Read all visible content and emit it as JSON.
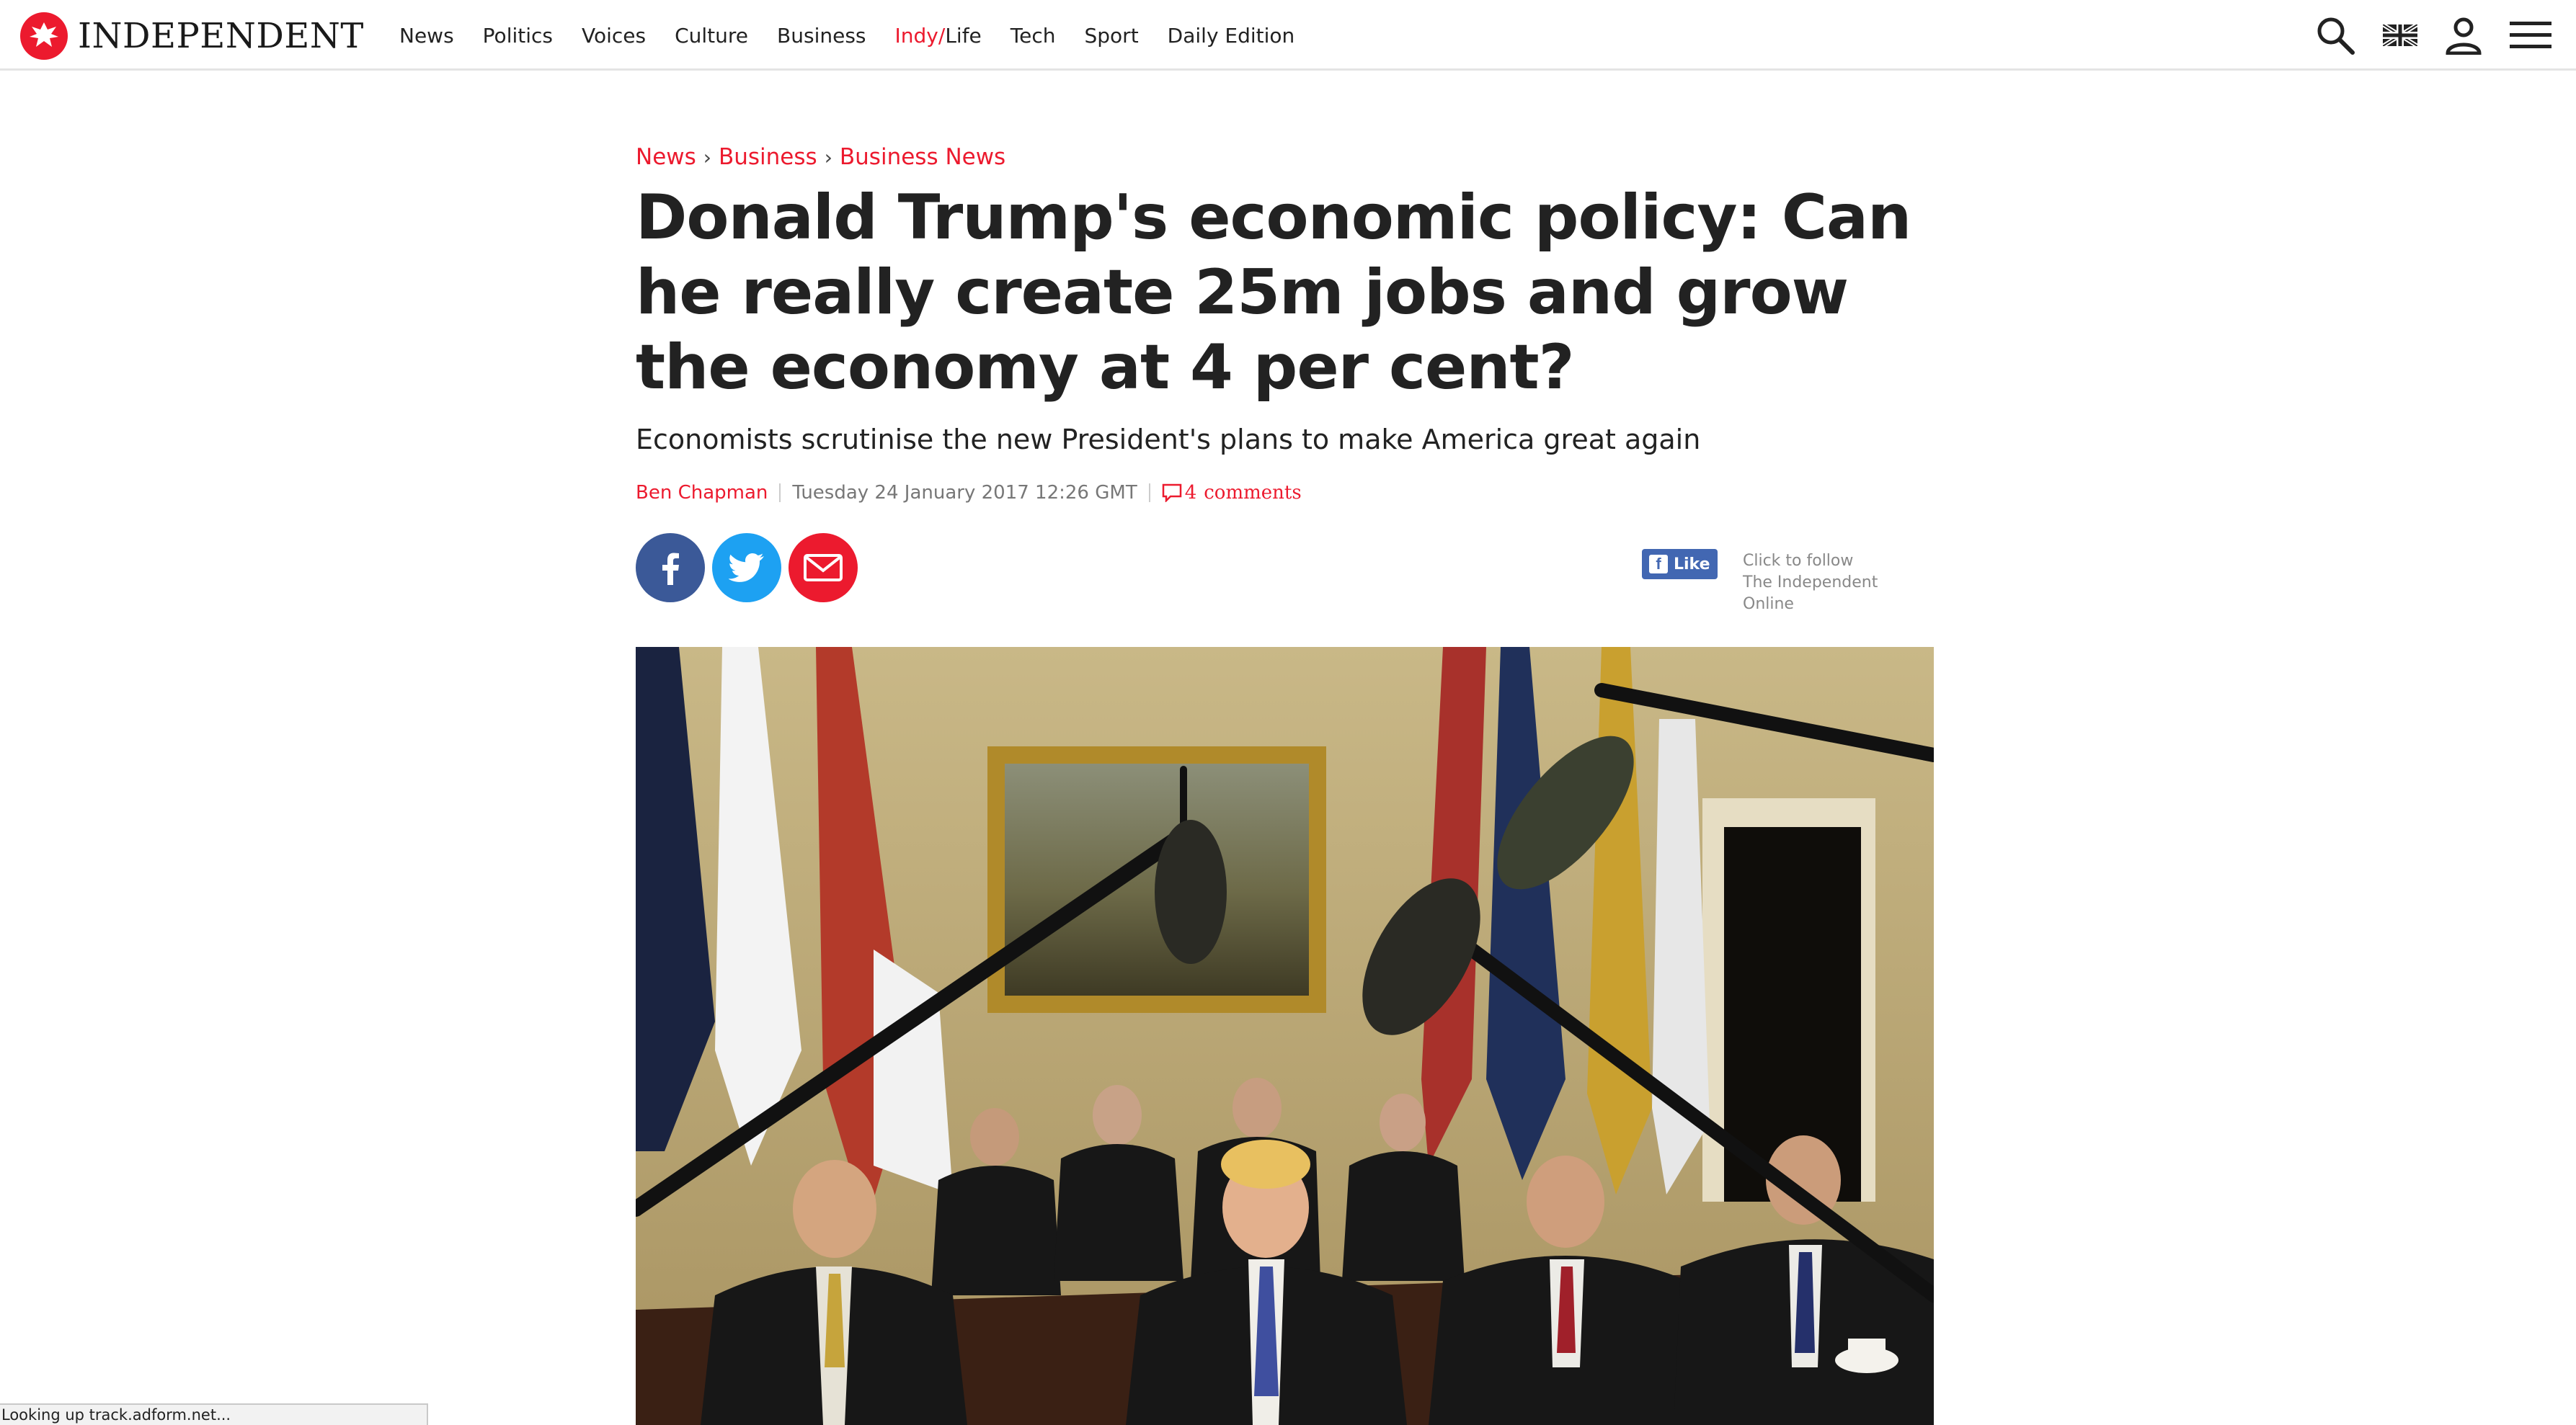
{
  "brand": {
    "name": "INDEPENDENT",
    "accent": "#ec1a2e"
  },
  "nav": {
    "items": [
      "News",
      "Politics",
      "Voices",
      "Culture",
      "Business"
    ],
    "indy_prefix": "Indy/",
    "indy_suffix": "Life",
    "items_after": [
      "Tech",
      "Sport",
      "Daily Edition"
    ]
  },
  "tools": {
    "icons": [
      "search-icon",
      "uk-flag-icon",
      "user-icon",
      "menu-icon"
    ]
  },
  "breadcrumb": {
    "items": [
      "News",
      "Business",
      "Business News"
    ],
    "separator": "›"
  },
  "article": {
    "headline": "Donald Trump's economic policy: Can he really create 25m jobs and grow the economy at 4 per cent?",
    "standfirst": "Economists scrutinise the new President's plans to make America great again",
    "author": "Ben Chapman",
    "date": "Tuesday 24 January 2017 12:26 GMT",
    "comments_count": "4",
    "comments_label": "comments"
  },
  "share": {
    "icons": [
      "facebook-icon",
      "twitter-icon",
      "email-icon"
    ]
  },
  "facebook": {
    "like_label": "Like",
    "follow_line1": "Click to follow",
    "follow_line2": "The Independent Online"
  },
  "status": {
    "text": "Looking up track.adform.net..."
  }
}
